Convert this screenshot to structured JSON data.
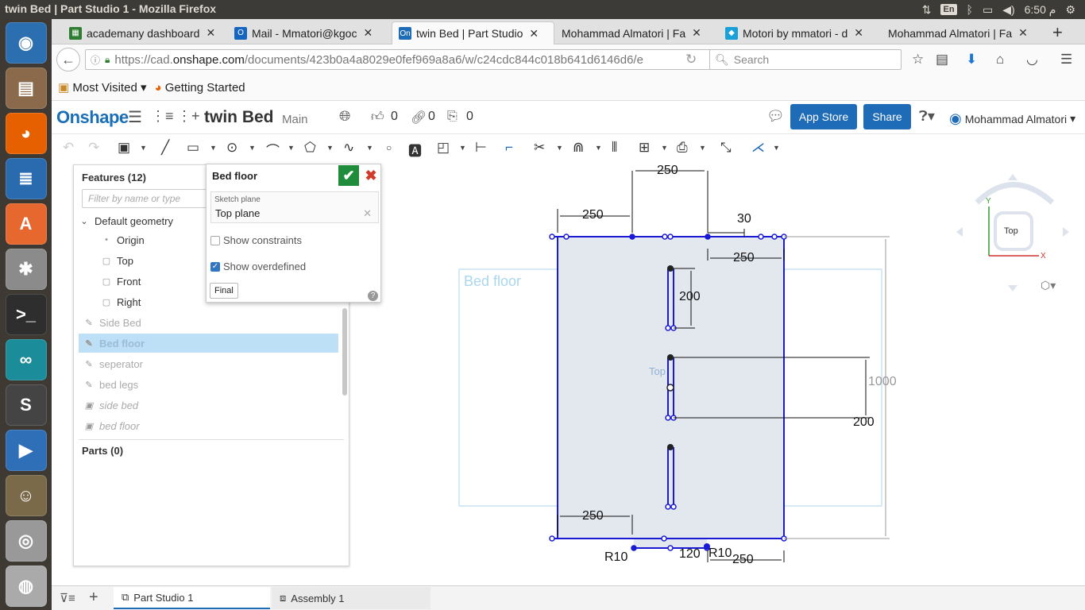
{
  "os": {
    "window_title": "twin Bed | Part Studio 1 - Mozilla Firefox",
    "keyboard": "En",
    "time": "6:50 م"
  },
  "launcher": {
    "items": [
      {
        "name": "ubuntu-dash-icon",
        "glyph": "◉",
        "color": "#2c6fb0"
      },
      {
        "name": "files-icon",
        "glyph": "▤",
        "color": "#8a6a4a"
      },
      {
        "name": "firefox-icon",
        "glyph": "◕",
        "color": "#e66000"
      },
      {
        "name": "writer-icon",
        "glyph": "≣",
        "color": "#2a6bb0"
      },
      {
        "name": "software-center-icon",
        "glyph": "A",
        "color": "#e6682f"
      },
      {
        "name": "settings-icon",
        "glyph": "✱",
        "color": "#8b8b8b"
      },
      {
        "name": "terminal-icon",
        "glyph": ">_",
        "color": "#2e2e2e"
      },
      {
        "name": "arduino-icon",
        "glyph": "∞",
        "color": "#1b8c9a"
      },
      {
        "name": "sublime-icon",
        "glyph": "S",
        "color": "#444"
      },
      {
        "name": "media-player-icon",
        "glyph": "▶",
        "color": "#2f6fb8"
      },
      {
        "name": "gimp-icon",
        "glyph": "☺",
        "color": "#7a6a4a"
      },
      {
        "name": "camera-icon",
        "glyph": "◎",
        "color": "#999"
      },
      {
        "name": "disk-icon",
        "glyph": "◍",
        "color": "#aaa"
      }
    ]
  },
  "browser": {
    "tabs": [
      {
        "label": "academany dashboard",
        "fav_color": "#2e7d32",
        "fav": "▦"
      },
      {
        "label": "Mail - Mmatori@kgoc",
        "fav_color": "#1565c0",
        "fav": "O"
      },
      {
        "label": "twin Bed | Part Studio",
        "fav_color": "#1e6bb8",
        "fav": "On",
        "active": true
      },
      {
        "label": "Mohammad Almatori | Fa",
        "fav_color": "",
        "fav": ""
      },
      {
        "label": "Motori by mmatori - d",
        "fav_color": "#1aa0d8",
        "fav": "◆"
      },
      {
        "label": "Mohammad Almatori | Fa",
        "fav_color": "",
        "fav": ""
      }
    ],
    "url_prefix": "https://cad.",
    "url_domain": "onshape.com",
    "url_rest": "/documents/423b0a4a8029e0fef969a8a6/w/c24cdc844c018b641d6146d6/e",
    "search_placeholder": "Search",
    "bookmarks": [
      "Most Visited",
      "Getting Started"
    ]
  },
  "onshape": {
    "logo": "Onshape",
    "doc_title": "twin Bed",
    "branch": "Main",
    "likes": "0",
    "links": "0",
    "copies": "0",
    "app_store": "App Store",
    "share": "Share",
    "user_name": "Mohammad Almatori"
  },
  "features": {
    "header": "Features (12)",
    "filter_placeholder": "Filter by name or type",
    "default_geometry": "Default geometry",
    "items": [
      {
        "label": "Origin",
        "kind": "origin"
      },
      {
        "label": "Top",
        "kind": "plane"
      },
      {
        "label": "Front",
        "kind": "plane"
      },
      {
        "label": "Right",
        "kind": "plane"
      },
      {
        "label": "Side Bed",
        "kind": "sketch"
      },
      {
        "label": "Bed floor",
        "kind": "sketch",
        "selected": true
      },
      {
        "label": "seperator",
        "kind": "sketch"
      },
      {
        "label": "bed legs",
        "kind": "sketch"
      },
      {
        "label": "side bed",
        "kind": "extrude"
      },
      {
        "label": "bed floor",
        "kind": "extrude"
      }
    ],
    "parts_header": "Parts (0)"
  },
  "sketch_dialog": {
    "title": "Bed floor",
    "plane_label": "Sketch plane",
    "plane_value": "Top plane",
    "show_constraints": "Show constraints",
    "show_constraints_checked": false,
    "show_overdefined": "Show overdefined",
    "show_overdefined_checked": true,
    "final_button": "Final"
  },
  "viewport": {
    "plane_label": "Bed floor",
    "top_label": "Top",
    "dimensions": [
      "250",
      "250",
      "30",
      "250",
      "200",
      "1000",
      "200",
      "250",
      "R10",
      "120",
      "R10",
      "250"
    ],
    "viewcube_face": "Top",
    "axis_y": "Y",
    "axis_x": "X"
  },
  "bottom_tabs": [
    "Part Studio 1",
    "Assembly 1"
  ]
}
